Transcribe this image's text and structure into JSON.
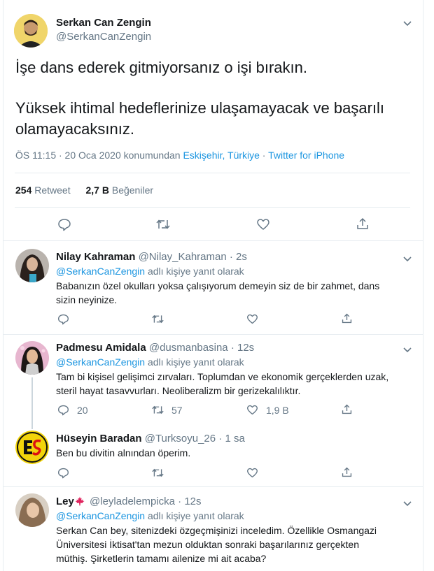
{
  "main_tweet": {
    "author_name": "Serkan Can Zengin",
    "author_handle": "@SerkanCanZengin",
    "text_line1": "İşe dans ederek gitmiyorsanız o işi bırakın.",
    "text_line2": "Yüksek ihtimal hedeflerinize ulaşamayacak ve başarılı",
    "text_line3": "olamayacaksınız.",
    "time": "ÖS 11:15 · 20 Oca 2020 konumundan ",
    "location": "Eskişehir, Türkiye",
    "sep": " · ",
    "source": "Twitter for iPhone",
    "retweet_count": "254",
    "retweet_label": "Retweet",
    "like_count": "2,7 B",
    "like_label": "Beğeniler"
  },
  "replies": [
    {
      "name": "Nilay Kahraman",
      "handle": "@Nilay_Kahraman",
      "time": "2s",
      "reply_to_handle": "@SerkanCanZengin",
      "reply_to_suffix": " adlı kişiye yanıt olarak",
      "line1": "Babanızın özel okulları yoksa çalışıyorum demeyin siz de bir zahmet, dans",
      "line2": "sizin neyinize."
    },
    {
      "name": "Padmesu Amidala",
      "handle": "@dusmanbasina",
      "time": "12s",
      "reply_to_handle": "@SerkanCanZengin",
      "reply_to_suffix": " adlı kişiye yanıt olarak",
      "line1": "Tam bi kişisel gelişimci zırvaları. Toplumdan ve ekonomik gerçeklerden uzak,",
      "line2": "steril hayat tasavvurları. Neoliberalizm bir gerizekalılıktır.",
      "reply_count": "20",
      "retweet_count": "57",
      "like_count": "1,9 B"
    },
    {
      "name": "Hüseyin Baradan",
      "handle": "@Turksoyu_26",
      "time": "1 sa",
      "line1": "Ben bu divitin alnından öperim."
    },
    {
      "name": "Ley",
      "handle": "@leyladelempicka",
      "time": "12s",
      "reply_to_handle": "@SerkanCanZengin",
      "reply_to_suffix": " adlı kişiye yanıt olarak",
      "line1": "Serkan Can bey, sitenizdeki özgeçmişinizi inceledim. Özellikle Osmangazi",
      "line2": "Üniversitesi İktisat'tan mezun olduktan sonraki başarılarınız gerçekten",
      "line3": "müthiş. Şirketlerin tamamı ailenize mi ait acaba?"
    }
  ],
  "colors": {
    "accent": "#1b95e0",
    "muted": "#657786",
    "border": "#e6ecf0"
  }
}
